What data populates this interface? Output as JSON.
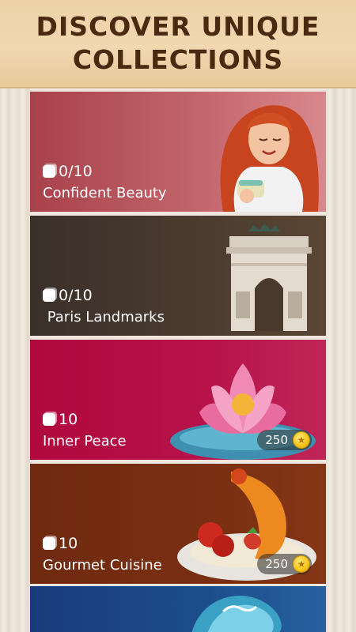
{
  "header": {
    "title_line1": "DISCOVER UNIQUE",
    "title_line2": "COLLECTIONS"
  },
  "collections": [
    {
      "count": "0/10",
      "name": "Confident Beauty",
      "color": "#b3545a",
      "art": "woman-with-cup-icon"
    },
    {
      "count": "0/10",
      "name": " Paris Landmarks",
      "color": "#4a3a2e",
      "art": "arc-de-triomphe-icon"
    },
    {
      "count": "10",
      "name": "Inner Peace",
      "color": "#b20f45",
      "art": "lotus-flower-icon",
      "price": "250"
    },
    {
      "count": "10",
      "name": "Gourmet Cuisine",
      "color": "#7a2d10",
      "art": "dessert-plate-icon",
      "price": "250"
    },
    {
      "count": "",
      "name": "",
      "color": "#1d4e8c",
      "art": "ocean-wave-icon"
    }
  ]
}
